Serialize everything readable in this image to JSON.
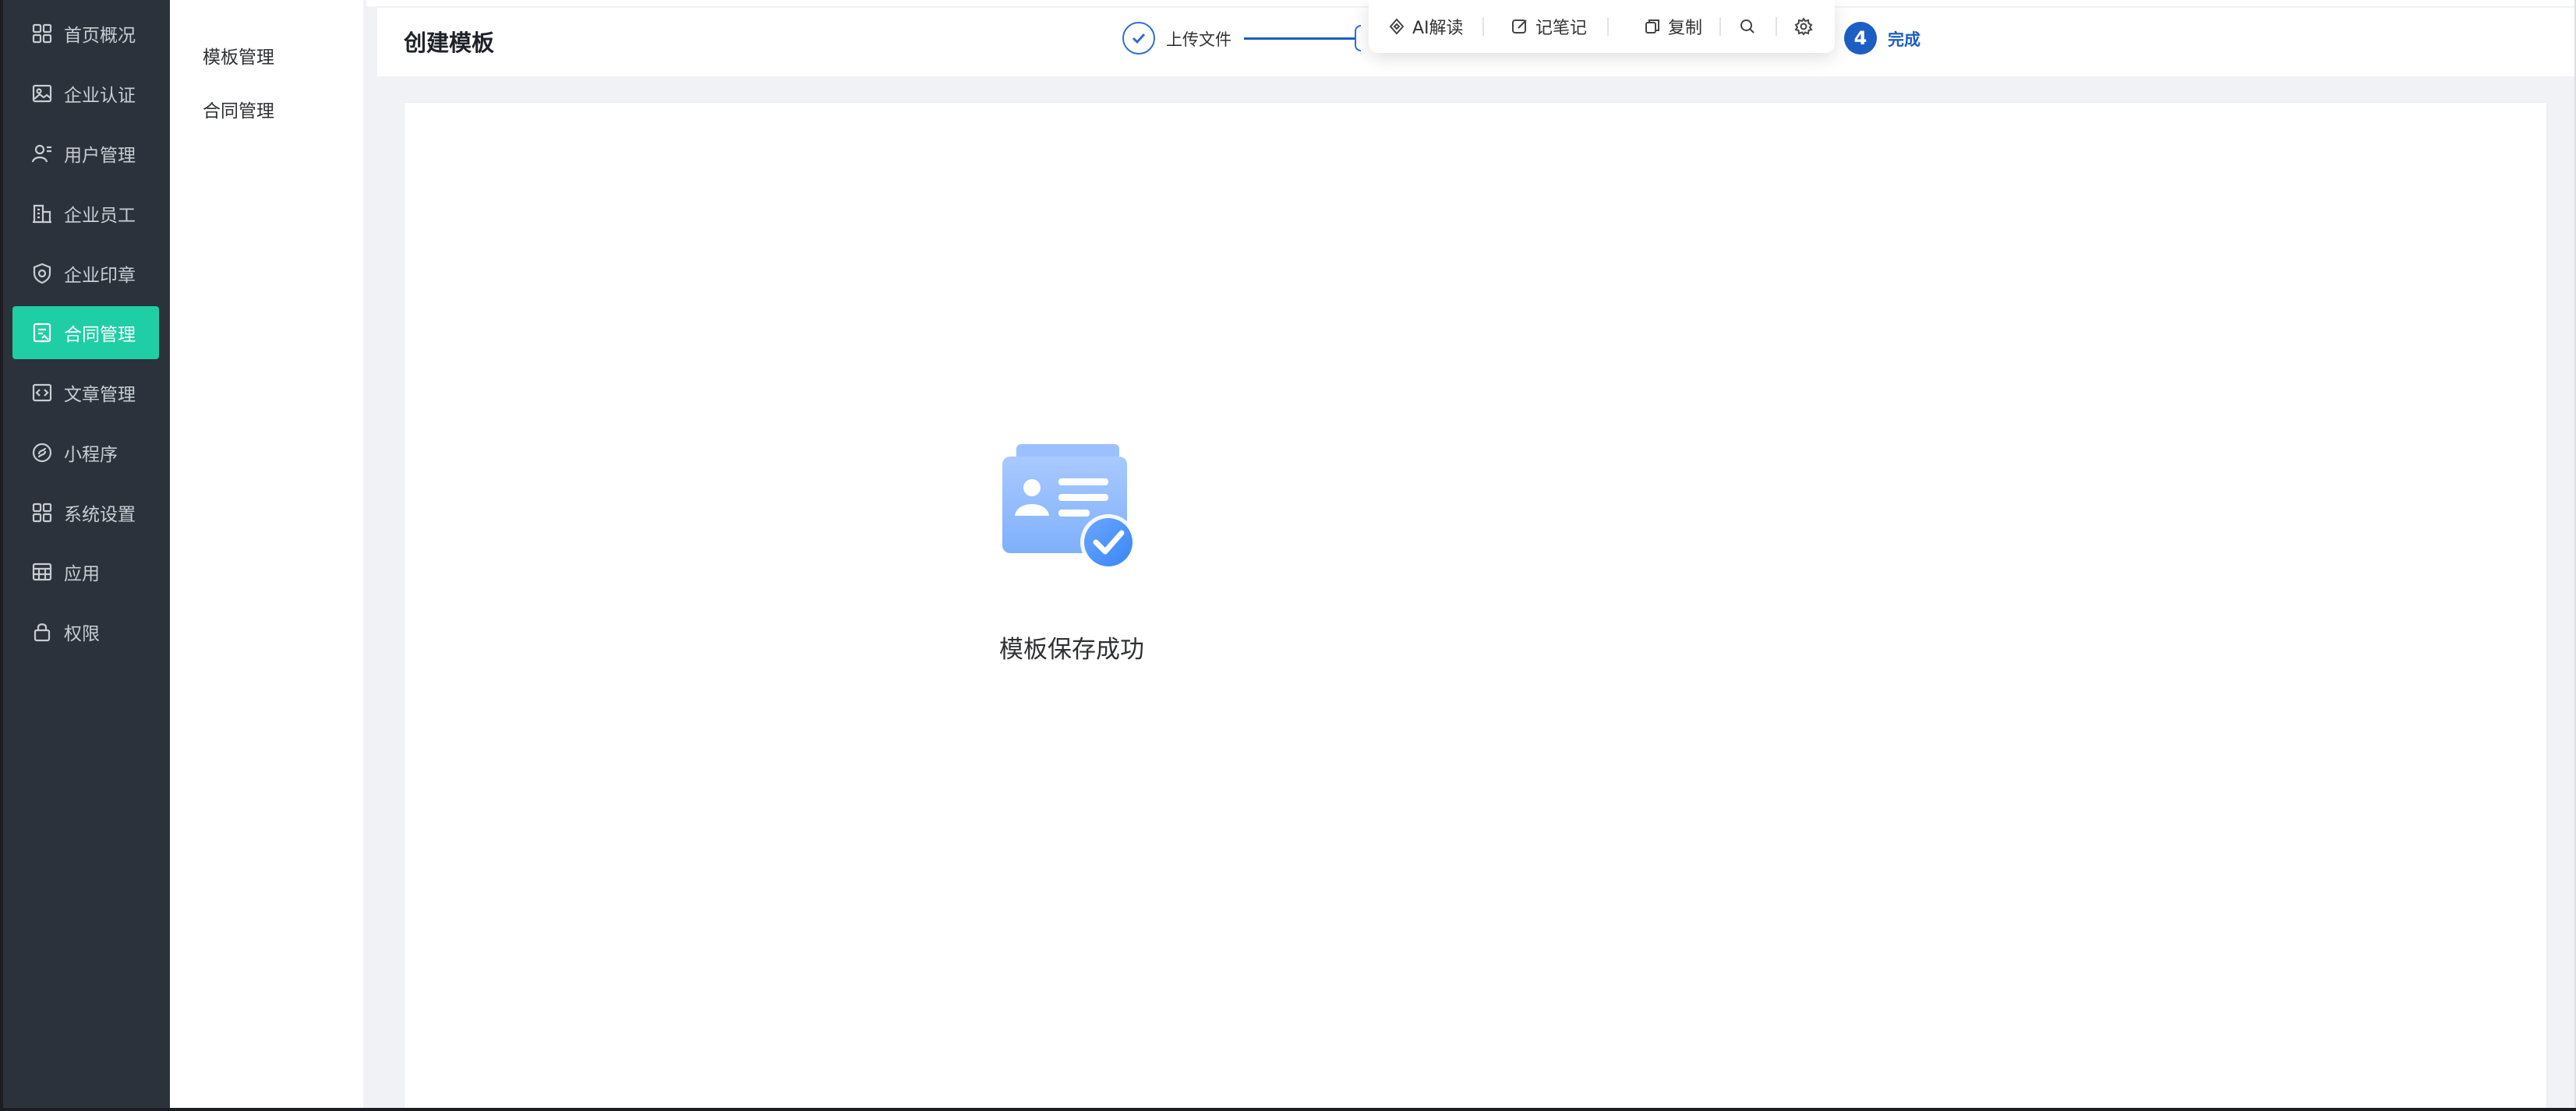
{
  "nav": {
    "items": [
      {
        "label": "首页概况",
        "icon": "dashboard-icon",
        "active": false
      },
      {
        "label": "企业认证",
        "icon": "image-card-icon",
        "active": false
      },
      {
        "label": "用户管理",
        "icon": "user-manage-icon",
        "active": false
      },
      {
        "label": "企业员工",
        "icon": "building-icon",
        "active": false
      },
      {
        "label": "企业印章",
        "icon": "shield-seal-icon",
        "active": false
      },
      {
        "label": "合同管理",
        "icon": "contract-icon",
        "active": true
      },
      {
        "label": "文章管理",
        "icon": "article-icon",
        "active": false
      },
      {
        "label": "小程序",
        "icon": "miniprogram-icon",
        "active": false
      },
      {
        "label": "系统设置",
        "icon": "settings-grid-icon",
        "active": false
      },
      {
        "label": "应用",
        "icon": "app-table-icon",
        "active": false
      },
      {
        "label": "权限",
        "icon": "lock-icon",
        "active": false
      }
    ],
    "active_color": "#1fcea5",
    "bg_color": "#2b323b"
  },
  "subnav": {
    "items": [
      {
        "label": "模板管理"
      },
      {
        "label": "合同管理"
      }
    ]
  },
  "header": {
    "title": "创建模板"
  },
  "steps": {
    "step1": {
      "label": "上传文件",
      "state": "done"
    },
    "step4": {
      "number": "4",
      "label": "完成",
      "state": "current"
    },
    "accent_color": "#1d5ec4"
  },
  "result": {
    "message": "模板保存成功",
    "icon": "template-saved-card-check-icon"
  },
  "toolbar": {
    "ai_label": "AI解读",
    "note_label": "记笔记",
    "copy_label": "复制",
    "search_icon": "search-icon",
    "settings_icon": "gear-icon"
  }
}
